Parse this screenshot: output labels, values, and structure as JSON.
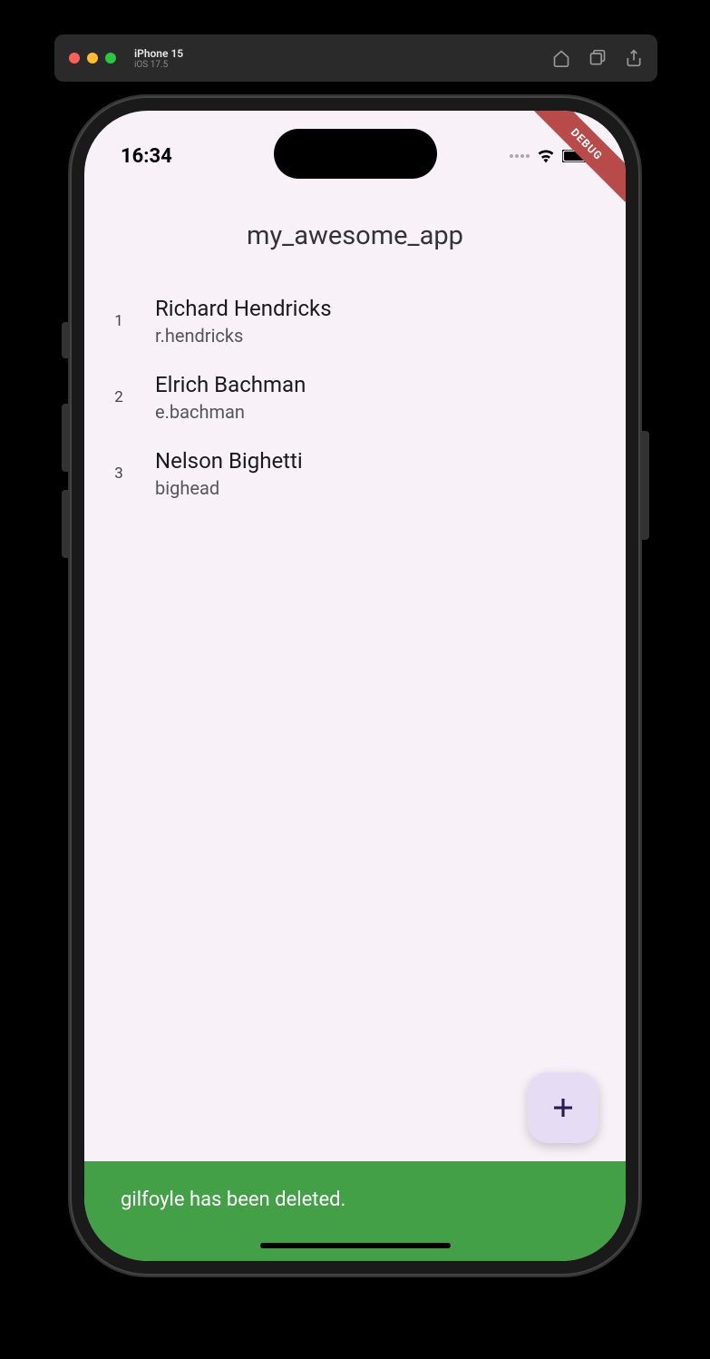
{
  "simulator": {
    "device": "iPhone 15",
    "os": "iOS 17.5"
  },
  "status_bar": {
    "time": "16:34"
  },
  "debug_banner": "DEBUG",
  "app": {
    "title": "my_awesome_app"
  },
  "list": [
    {
      "index": "1",
      "name": "Richard Hendricks",
      "username": "r.hendricks"
    },
    {
      "index": "2",
      "name": "Elrich Bachman",
      "username": "e.bachman"
    },
    {
      "index": "3",
      "name": "Nelson Bighetti",
      "username": "bighead"
    }
  ],
  "snackbar": {
    "message": "gilfoyle has been deleted."
  },
  "colors": {
    "screen_bg": "#f8f2f8",
    "snackbar_bg": "#43a047",
    "fab_bg": "#e6ddf5",
    "fab_icon": "#2a1a5a",
    "debug_bg": "#b94a4a"
  }
}
